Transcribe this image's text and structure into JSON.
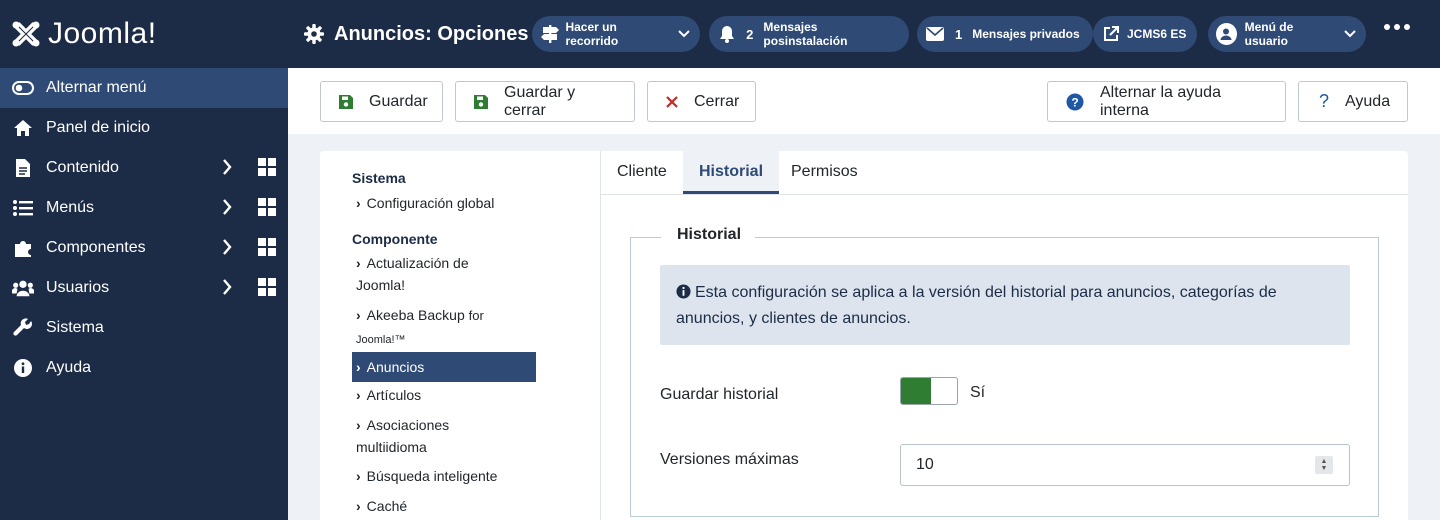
{
  "brand": {
    "name": "Joomla!"
  },
  "sidebar": {
    "toggle_label": "Alternar menú",
    "items": [
      {
        "label": "Panel de inicio",
        "icon": "home-icon"
      },
      {
        "label": "Contenido",
        "icon": "file-icon"
      },
      {
        "label": "Menús",
        "icon": "list-icon"
      },
      {
        "label": "Componentes",
        "icon": "puzzle-icon"
      },
      {
        "label": "Usuarios",
        "icon": "users-icon"
      },
      {
        "label": "Sistema",
        "icon": "wrench-icon"
      },
      {
        "label": "Ayuda",
        "icon": "info-icon"
      }
    ]
  },
  "header": {
    "title": "Anuncios: Opciones",
    "tour_label": "Hacer un recorrido",
    "postinstall_count": "2",
    "postinstall_label": "Mensajes posinstalación",
    "private_count": "1",
    "private_label": "Mensajes privados",
    "site_label": "JCMS6 ES",
    "user_menu_label": "Menú de usuario"
  },
  "toolbar": {
    "save_label": "Guardar",
    "save_close_label": "Guardar y cerrar",
    "close_label": "Cerrar",
    "inline_help_label": "Alternar la ayuda interna",
    "help_label": "Ayuda"
  },
  "leftnav": {
    "system_heading": "Sistema",
    "global_config": "Configuración global",
    "component_heading": "Componente",
    "items": {
      "joomla_update_1": "Actualización de",
      "joomla_update_2": "Joomla!",
      "akeeba_1": "Akeeba Backup",
      "akeeba_for": "for",
      "akeeba_2": "Joomla!™",
      "banners": "Anuncios",
      "articles": "Artículos",
      "associations_1": "Asociaciones",
      "associations_2": "multiidioma",
      "smart_search": "Búsqueda inteligente",
      "cache": "Caché"
    }
  },
  "tabs": {
    "client": "Cliente",
    "history": "Historial",
    "permissions": "Permisos"
  },
  "panel": {
    "legend": "Historial",
    "alert_text": "Esta configuración se aplica a la versión del historial para anuncios, categorías de anuncios, y clientes de anuncios.",
    "save_history_label": "Guardar historial",
    "save_history_value": "Sí",
    "max_versions_label": "Versiones máximas",
    "max_versions_value": "10"
  },
  "colors": {
    "navy": "#1c2b46",
    "accent": "#2f4a74",
    "green": "#2f7d32",
    "red": "#c52827"
  }
}
